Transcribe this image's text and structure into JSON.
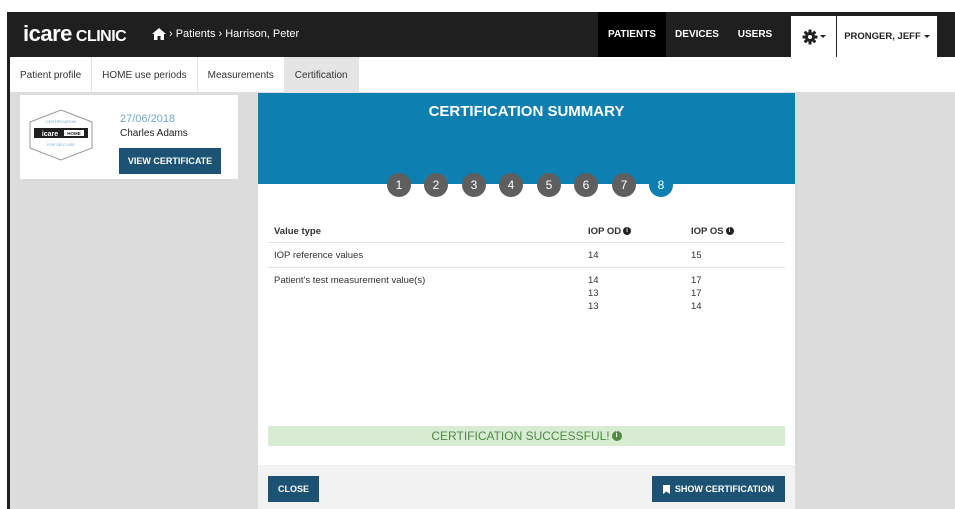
{
  "header": {
    "logo_brand": "icare",
    "logo_product": "CLINIC",
    "breadcrumb": "› Patients › Harrison, Peter",
    "nav": [
      "PATIENTS",
      "DEVICES",
      "USERS"
    ],
    "user_name": "PRONGER, JEFF"
  },
  "tabs": [
    "Patient profile",
    "HOME use periods",
    "Measurements",
    "Certification"
  ],
  "active_tab": "Certification",
  "certificate_card": {
    "date": "27/06/2018",
    "name": "Charles Adams",
    "button_label": "VIEW CERTIFICATE",
    "badge_top": "CERTIFICATION",
    "badge_brand": "icare",
    "badge_home": "HOME",
    "badge_bottom": "FOR SELF-USE"
  },
  "modal": {
    "title": "CERTIFICATION SUMMARY",
    "steps": [
      "1",
      "2",
      "3",
      "4",
      "5",
      "6",
      "7",
      "8"
    ],
    "active_step": "8",
    "table": {
      "headers": [
        "Value type",
        "IOP OD",
        "IOP OS"
      ],
      "rows": [
        {
          "label": "IOP reference values",
          "od": [
            "14"
          ],
          "os": [
            "15"
          ]
        },
        {
          "label": "Patient's test measurement value(s)",
          "od": [
            "14",
            "13",
            "13"
          ],
          "os": [
            "17",
            "17",
            "14"
          ]
        }
      ]
    },
    "success_message": "CERTIFICATION SUCCESSFUL!",
    "close_label": "CLOSE",
    "show_label": "SHOW CERTIFICATION"
  },
  "colors": {
    "accent": "#0d80b1",
    "button": "#1c5374",
    "topbar": "#1f1f1f",
    "success_bg": "#d8ebd3",
    "success_text": "#4f8b45"
  }
}
